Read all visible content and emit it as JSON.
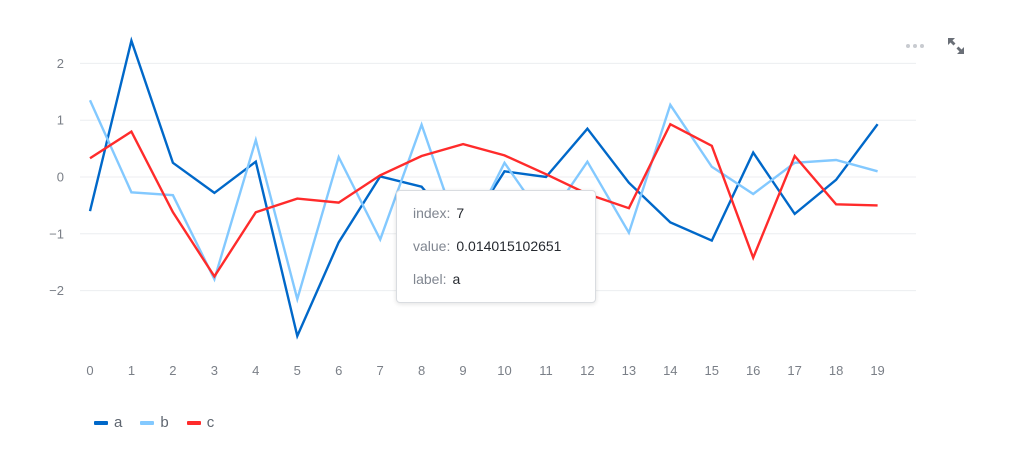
{
  "chart_data": {
    "type": "line",
    "x": [
      0,
      1,
      2,
      3,
      4,
      5,
      6,
      7,
      8,
      9,
      10,
      11,
      12,
      13,
      14,
      15,
      16,
      17,
      18,
      19
    ],
    "ylim": [
      -3.3,
      2.4
    ],
    "yticks": [
      2,
      1,
      0,
      -1,
      -2
    ],
    "grid": true,
    "legend_position": "bottom-left",
    "series": [
      {
        "name": "a",
        "color": "#0068c9",
        "values": [
          -0.6,
          2.4,
          0.25,
          -0.28,
          0.27,
          -2.8,
          -1.15,
          0.01,
          -0.17,
          -1.05,
          0.1,
          0.0,
          0.85,
          -0.1,
          -0.8,
          -1.12,
          0.43,
          -0.65,
          -0.05,
          0.93
        ]
      },
      {
        "name": "b",
        "color": "#83c9ff",
        "values": [
          1.35,
          -0.27,
          -0.32,
          -1.8,
          0.65,
          -2.15,
          0.35,
          -1.1,
          0.92,
          -1.2,
          0.25,
          -0.8,
          0.27,
          -0.98,
          1.27,
          0.18,
          -0.3,
          0.25,
          0.3,
          0.1
        ]
      },
      {
        "name": "c",
        "color": "#ff2b2b",
        "values": [
          0.33,
          0.8,
          -0.62,
          -1.75,
          -0.62,
          -0.38,
          -0.45,
          0.03,
          0.37,
          0.58,
          0.38,
          0.05,
          -0.3,
          -0.55,
          0.93,
          0.55,
          -1.42,
          0.37,
          -0.48,
          -0.5
        ]
      }
    ]
  },
  "tooltip": {
    "index_key": "index:",
    "index_value": "7",
    "value_key": "value:",
    "value_value": "0.014015102651",
    "label_key": "label:",
    "label_value": "a"
  },
  "toolbar": {
    "menu_icon": "more-horizontal-icon",
    "fullscreen_icon": "expand-icon"
  }
}
